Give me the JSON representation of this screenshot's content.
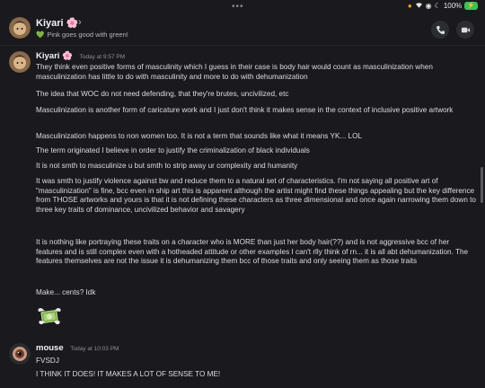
{
  "status_bar": {
    "battery": "100%"
  },
  "header": {
    "name": "Kiyari",
    "name_emoji": "🌸",
    "chevron": "›",
    "status_heart": "💚",
    "status_text": "Pink goes good with green!",
    "call_icon": "phone-icon",
    "video_icon": "video-icon"
  },
  "messages": [
    {
      "author": "Kiyari",
      "author_emoji": "🌸",
      "time": "Today at 9:57 PM",
      "paragraphs": [
        "They think even positive forms of masculinity which I guess in their case is body hair would count as masculinization when masculinization has little to do with masculinity and more to do with dehumanization",
        "The idea that WOC do not need defending, that they're brutes, uncivilized, etc",
        "Masculinization is another form of caricature work and I just don't think it makes sense in the context of inclusive positive artwork",
        "Masculinization happens to non women too. It is not a term that sounds like what it means YK... LOL",
        "The term originated I believe in order to justify the criminalization of black individuals",
        "It is not smth to masculinize u but smth to strip away ur complexity and humanity",
        "It was smth to justify violence against bw and reduce them to a natural set of characteristics. I'm not saying all positive art of \"masculinization\" is fine, bcc even in ship art this is apparent although the artist might find these things appealing but the key difference from THOSE artworks and yours is that it is not defining these characters as three dimensional and once again narrowing them down to three key traits of dominance, uncivilized behavior and savagery",
        "It is nothing like portraying these traits on a character who is MORE than just her body hair(??) and is not aggressive bcc of her features and is still complex even with a hotheaded attitude or other examples I can't rlly think of rn... it is all abt dehumanization. The features themselves are not the issue it is dehumanizing them bcc of those traits and only seeing them as those traits",
        "Make... cents? Idk"
      ],
      "sticker": "money-with-wings-sticker"
    },
    {
      "author": "mouse",
      "time": "Today at 10:03 PM",
      "paragraphs": [
        "FVSDJ",
        "I THINK IT DOES! IT MAKES A LOT OF SENSE TO ME!"
      ]
    }
  ]
}
